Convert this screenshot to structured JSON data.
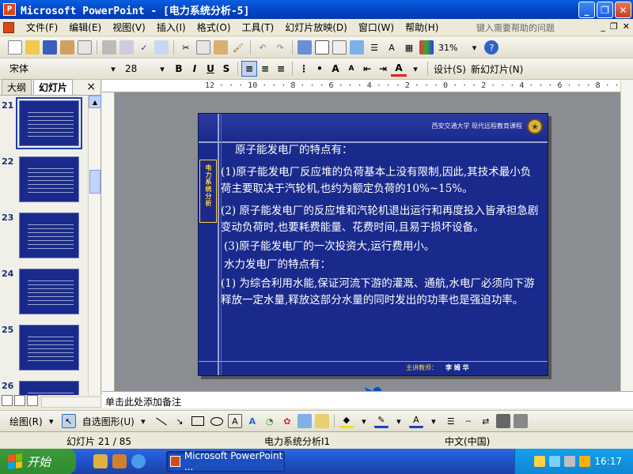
{
  "window": {
    "title": "Microsoft PowerPoint - [电力系统分析-5]",
    "app_icon": "P"
  },
  "menu": {
    "items": [
      "文件(F)",
      "编辑(E)",
      "视图(V)",
      "插入(I)",
      "格式(O)",
      "工具(T)",
      "幻灯片放映(D)",
      "窗口(W)",
      "帮助(H)"
    ],
    "help_placeholder": "键入需要帮助的问题"
  },
  "toolbar": {
    "zoom": "31%"
  },
  "format_toolbar": {
    "font_name": "宋体",
    "font_size": "28",
    "bold": "B",
    "italic": "I",
    "underline": "U",
    "shadow": "S",
    "design_label": "设计(S)",
    "new_slide_label": "新幻灯片(N)"
  },
  "pane": {
    "tab_outline": "大纲",
    "tab_slides": "幻灯片",
    "close": "×",
    "thumbnails": [
      {
        "num": "21",
        "selected": true
      },
      {
        "num": "22",
        "selected": false
      },
      {
        "num": "23",
        "selected": false
      },
      {
        "num": "24",
        "selected": false
      },
      {
        "num": "25",
        "selected": false
      },
      {
        "num": "26",
        "selected": false
      }
    ]
  },
  "ruler": {
    "text": "12 · · · 10 · · · 8 · · · 6 · · · 4 · · · 2 · · · 0 · · · 2 · · · 4 · · · 6 · · · 8 · · · 10 · · · 12"
  },
  "slide": {
    "header": "西安交通大学  现代远程教育课程",
    "side_label": "电力系统分析",
    "footer_label": "主讲教师：",
    "footer_name": "李 姆 华",
    "paragraphs": [
      "原子能发电厂的特点有：",
      "(1)原子能发电厂反应堆的负荷基本上没有限制,因此,其技术最小负荷主要取决于汽轮机,也约为额定负荷的10%~15%。",
      "(2) 原子能发电厂的反应堆和汽轮机退出运行和再度投入皆承担急剧变动负荷时,也要耗费能量、花费时间,且易于损坏设备。",
      "(3)原子能发电厂的一次投资大,运行费用小。",
      "水力发电厂的特点有：",
      "(1) 为综合利用水能,保证河流下游的灌溉、通航,水电厂必须向下游释放一定水量,释放这部分水量的同时发出的功率也是强迫功率。"
    ]
  },
  "notes": {
    "placeholder": "单击此处添加备注"
  },
  "drawing_toolbar": {
    "draw_label": "绘图(R)",
    "autoshapes_label": "自选图形(U)"
  },
  "status": {
    "slide": "幻灯片 21 / 85",
    "design": "电力系统分析I1",
    "language": "中文(中国)"
  },
  "taskbar": {
    "start": "开始",
    "task_title": "Microsoft PowerPoint ...",
    "clock": "16:17"
  }
}
